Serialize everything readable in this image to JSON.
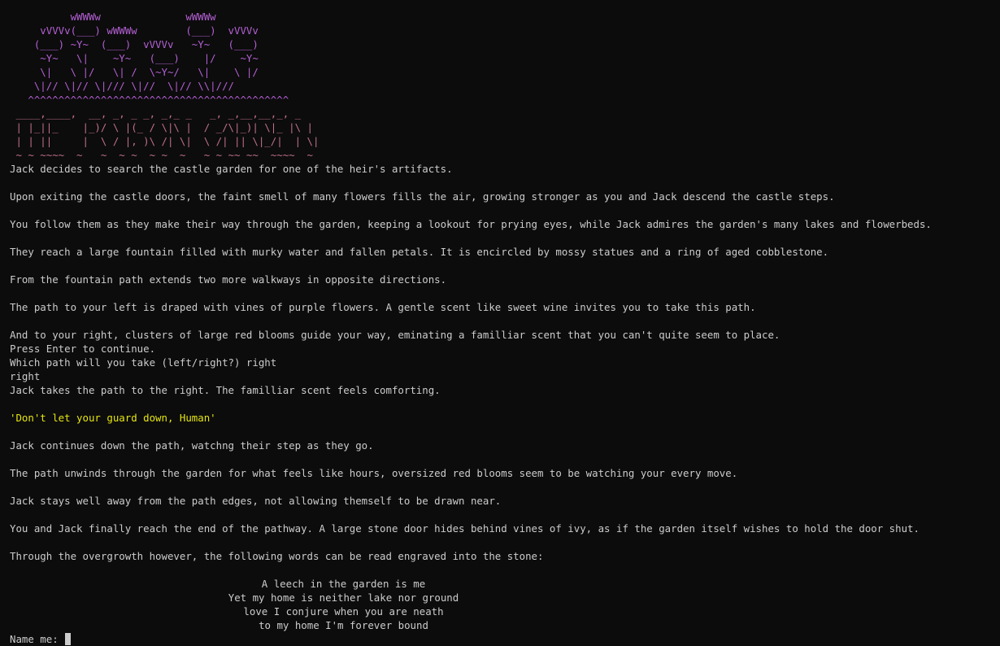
{
  "flower_art": "          wWWWw              wWWWw\n     vVVVv(___) wWWWw        (___)  vVVVv\n    (___) ~Y~  (___)  vVVVv   ~Y~   (___)\n     ~Y~   \\|    ~Y~   (___)    |/    ~Y~\n     \\|   \\ |/   \\| /  \\~Y~/   \\|    \\ |/\n    \\|// \\|// \\|/// \\|//  \\|// \\\\|///\n   ^^^^^^^^^^^^^^^^^^^^^^^^^^^^^^^^^^^^^^^^^^^",
  "title_art": " ____,____,  __, _, _ _, _,_ _   _, _,__,__,_, _\n | |_||_    |_)/ \\ |(_ / \\|\\ |  / _/\\|_)| \\|_ |\\ |\n | | ||     |  \\ / |, )\\ /| \\|  \\ /| || \\|_/|  | \\|\n ~ ~ ~~~~  ~   ~  ~ ~  ~ ~  ~   ~ ~ ~~ ~~  ~~~~  ~",
  "story": {
    "l1": "Jack decides to search the castle garden for one of the heir's artifacts.",
    "l2": "Upon exiting the castle doors, the faint smell of many flowers fills the air, growing stronger as you and Jack descend the castle steps.",
    "l3": "You follow them as they make their way through the garden, keeping a lookout for prying eyes, while Jack admires the garden's many lakes and flowerbeds.",
    "l4": "They reach a large fountain filled with murky water and fallen petals. It is encircled by mossy statues and a ring of aged cobblestone.",
    "l5": "From the fountain path extends two more walkways in opposite directions.",
    "l6": "The path to your left is draped with vines of purple flowers. A gentle scent like sweet wine invites you to take this path.",
    "l7": "And to your right, clusters of large red blooms guide your way, eminating a familliar scent that you can't quite seem to place.",
    "l8": "Press Enter to continue.",
    "l9": "Which path will you take (left/right?) right",
    "l10": "right",
    "l11": "Jack takes the path to the right. The familliar scent feels comforting.",
    "l12": "'Don't let your guard down, Human'",
    "l13": "Jack continues down the path, watchng their step as they go.",
    "l14": "The path unwinds through the garden for what feels like hours, oversized red blooms seem to be watching your every move.",
    "l15": "Jack stays well away from the path edges, not allowing themself to be drawn near.",
    "l16": "You and Jack finally reach the end of the pathway. A large stone door hides behind vines of ivy, as if the garden itself wishes to hold the door shut.",
    "l17": "Through the overgrowth however, the following words can be read engraved into the stone:"
  },
  "poem": [
    "A leech in the garden is me",
    "Yet my home is neither lake nor ground",
    "love I conjure when you are neath",
    "to my home I'm forever bound"
  ],
  "prompt": {
    "label": "Name me: "
  },
  "colors": {
    "background": "#0c0c0c",
    "text": "#cccccc",
    "flower_art": "#b460d4",
    "title_art": "#c0708a",
    "dialogue": "#e5e510"
  }
}
